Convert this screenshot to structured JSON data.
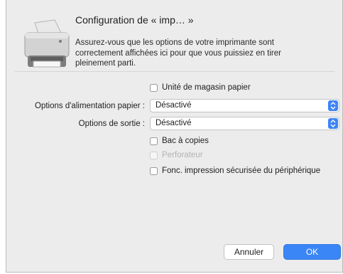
{
  "dialog": {
    "title": "Configuration de « imp… »",
    "description": "Assurez-vous que les options de votre imprimante sont correctement affichées ici pour que vous puissiez en tirer pleinement parti."
  },
  "options": {
    "paper_tray_unit": {
      "label": "Unité de magasin papier",
      "checked": false
    },
    "paper_feed": {
      "label": "Options d'alimentation papier :",
      "value": "Désactivé"
    },
    "output": {
      "label": "Options de sortie :",
      "value": "Désactivé"
    },
    "copy_tray": {
      "label": "Bac à copies",
      "checked": false
    },
    "puncher": {
      "label": "Perforateur",
      "checked": false,
      "enabled": false
    },
    "secure_print": {
      "label": "Fonc. impression sécurisée du périphérique",
      "checked": false
    }
  },
  "buttons": {
    "cancel": "Annuler",
    "ok": "OK"
  },
  "colors": {
    "accent": "#3b86f6",
    "dialog_bg": "#ececec"
  },
  "icons": {
    "printer": "printer-icon",
    "select_arrow": "updown-chevron-icon"
  }
}
